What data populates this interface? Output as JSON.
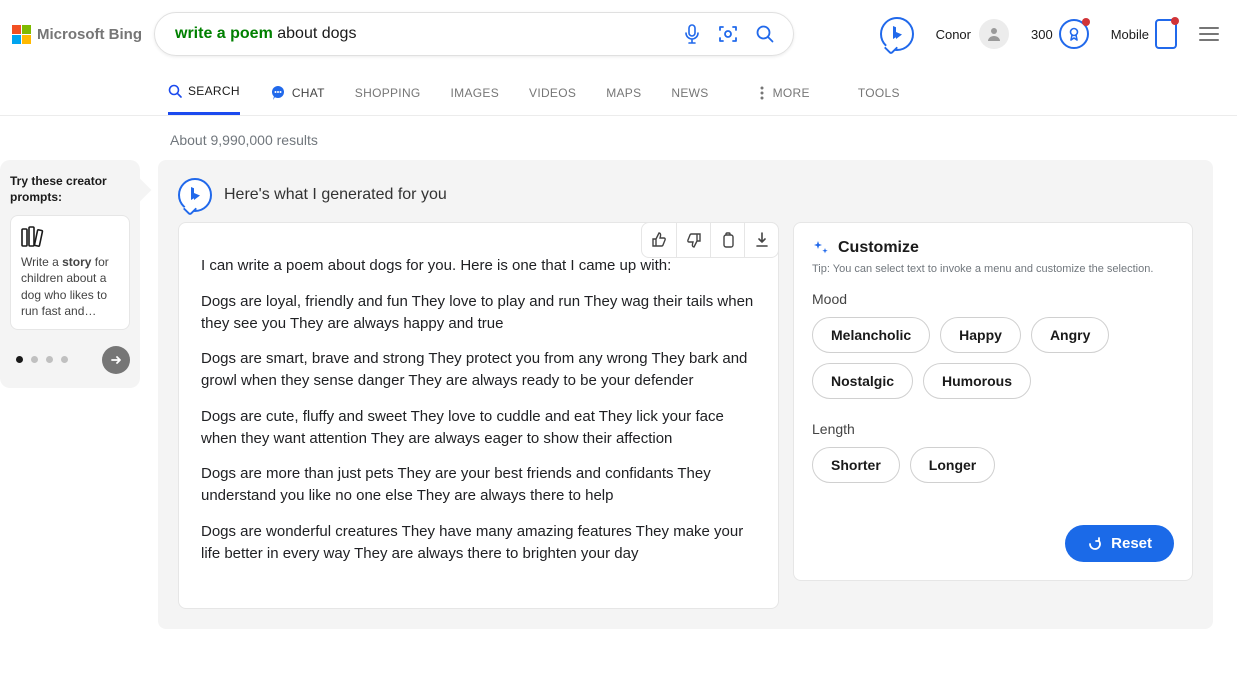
{
  "logo_text": "Microsoft Bing",
  "search": {
    "highlighted": "write a poem",
    "rest": " about dogs"
  },
  "user_name": "Conor",
  "points": "300",
  "mobile_label": "Mobile",
  "tabs": [
    "SEARCH",
    "CHAT",
    "SHOPPING",
    "IMAGES",
    "VIDEOS",
    "MAPS",
    "NEWS",
    "MORE",
    "TOOLS"
  ],
  "results_count": "About 9,990,000 results",
  "sidebar": {
    "title": "Try these creator prompts:",
    "card_pre": "Write a ",
    "card_bold": "story",
    "card_post": " for children about a dog who likes to run fast and…"
  },
  "gen_title": "Here's what I generated for you",
  "answer": {
    "p0": "I can write a poem about dogs for you. Here is one that I came up with:",
    "p1": "Dogs are loyal, friendly and fun They love to play and run They wag their tails when they see you They are always happy and true",
    "p2": "Dogs are smart, brave and strong They protect you from any wrong They bark and growl when they sense danger They are always ready to be your defender",
    "p3": "Dogs are cute, fluffy and sweet They love to cuddle and eat They lick your face when they want attention They are always eager to show their affection",
    "p4": "Dogs are more than just pets They are your best friends and confidants They understand you like no one else They are always there to help",
    "p5": "Dogs are wonderful creatures They have many amazing features They make your life better in every way They are always there to brighten your day"
  },
  "customize": {
    "title": "Customize",
    "tip": "Tip: You can select text to invoke a menu and customize the selection.",
    "mood_label": "Mood",
    "moods": [
      "Melancholic",
      "Happy",
      "Angry",
      "Nostalgic",
      "Humorous"
    ],
    "length_label": "Length",
    "lengths": [
      "Shorter",
      "Longer"
    ],
    "reset": "Reset"
  }
}
